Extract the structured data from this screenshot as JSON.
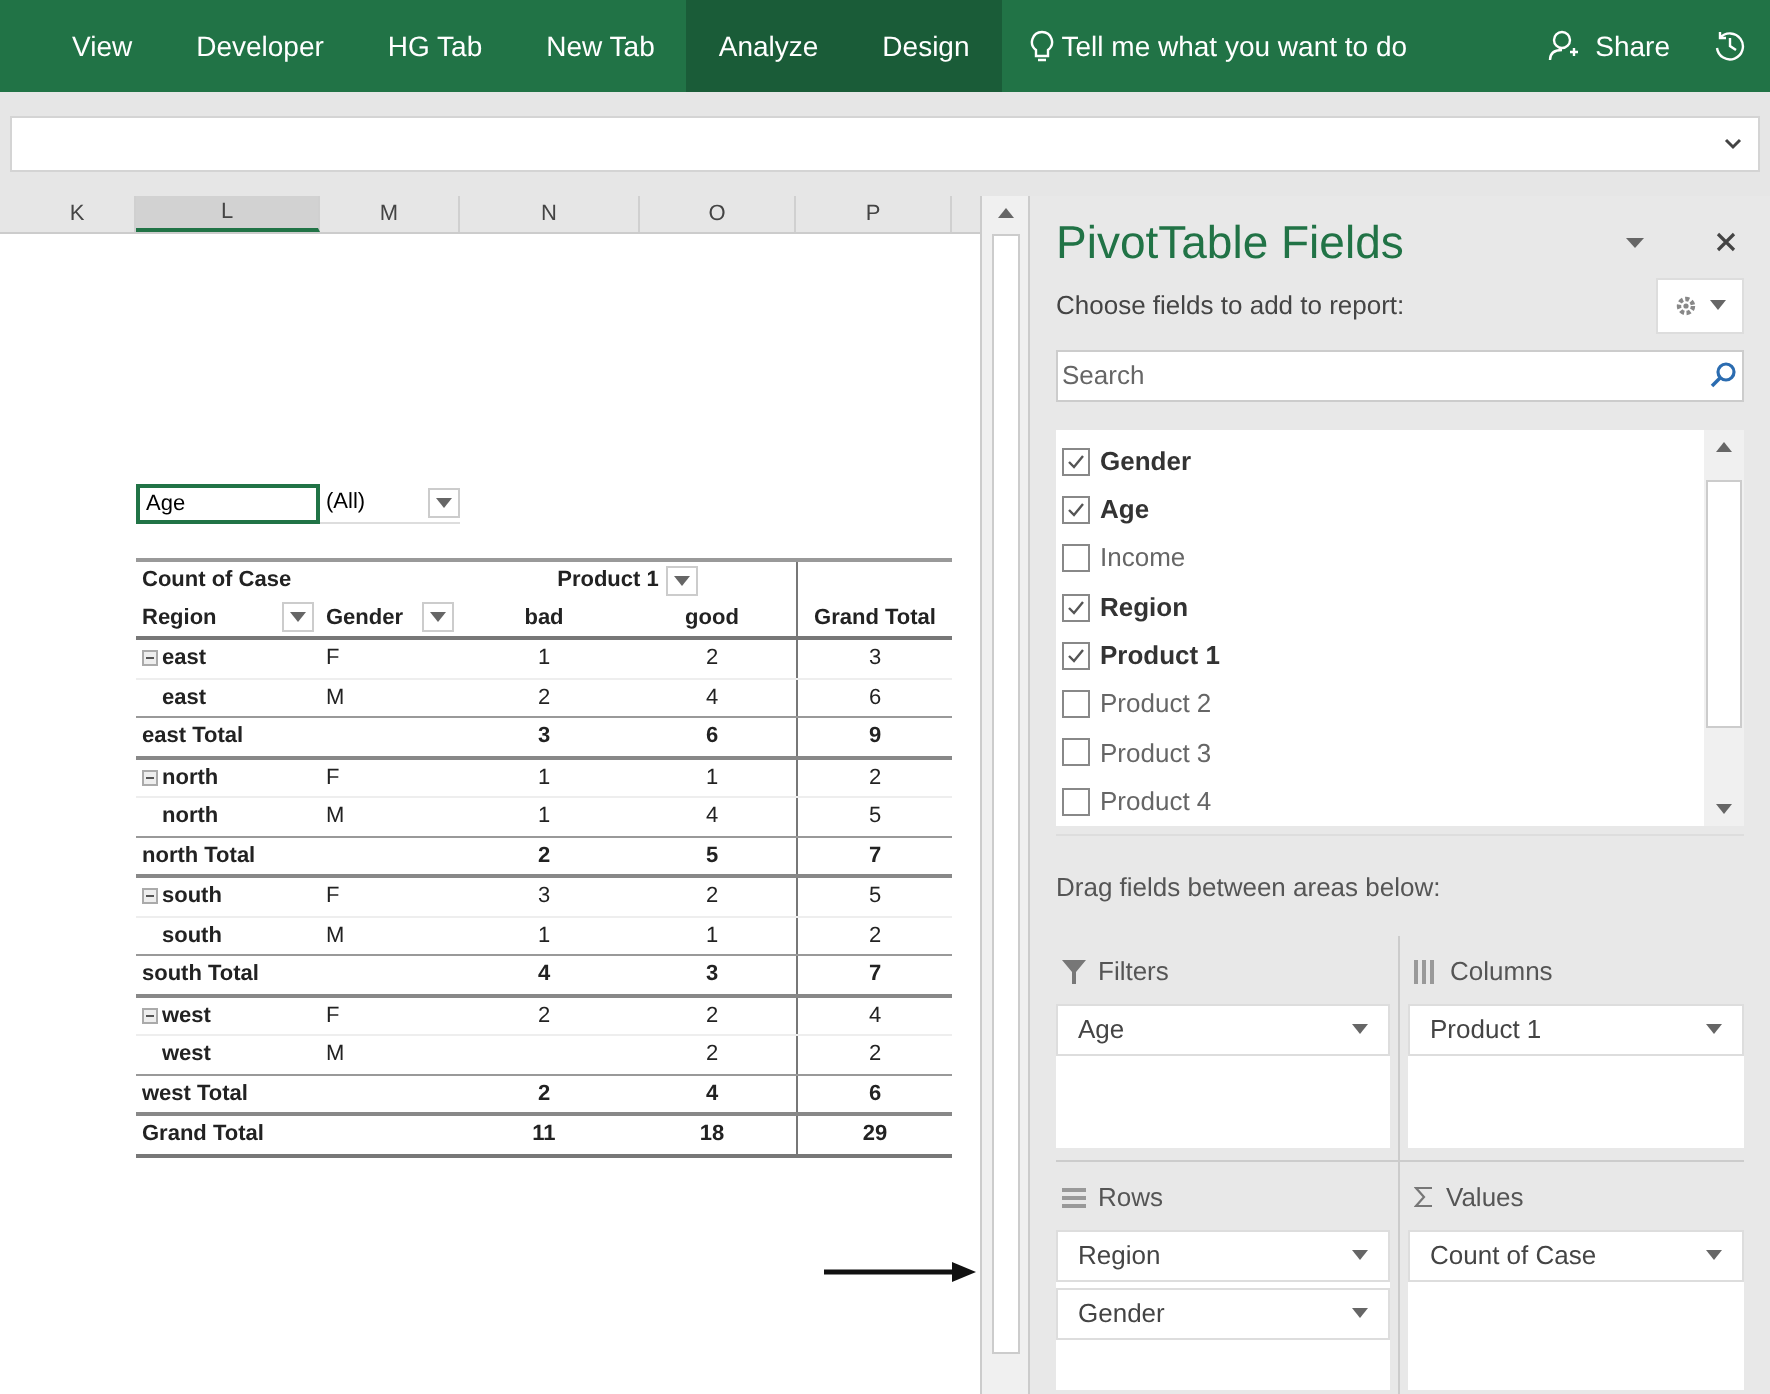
{
  "ribbon": {
    "tabs": [
      {
        "label": "View",
        "selected": false
      },
      {
        "label": "Developer",
        "selected": false
      },
      {
        "label": "HG Tab",
        "selected": false
      },
      {
        "label": "New Tab",
        "selected": false
      },
      {
        "label": "Analyze",
        "selected": true
      },
      {
        "label": "Design",
        "selected": true
      }
    ],
    "tell_me": "Tell me what you want to do",
    "share": "Share"
  },
  "column_headers": [
    {
      "label": "K",
      "selected": false
    },
    {
      "label": "L",
      "selected": true
    },
    {
      "label": "M",
      "selected": false
    },
    {
      "label": "N",
      "selected": false
    },
    {
      "label": "O",
      "selected": false
    },
    {
      "label": "P",
      "selected": false
    }
  ],
  "pivot": {
    "filter": {
      "field": "Age",
      "value": "(All)"
    },
    "values_label": "Count of Case",
    "column_field": "Product 1",
    "row_fields": [
      "Region",
      "Gender"
    ],
    "column_items": [
      "bad",
      "good"
    ],
    "grand_total_label": "Grand Total",
    "rows": [
      {
        "kind": "group_start",
        "region": "east",
        "gender": "F",
        "bad": "1",
        "good": "2",
        "total": "3"
      },
      {
        "kind": "item",
        "region": "east",
        "gender": "M",
        "bad": "2",
        "good": "4",
        "total": "6"
      },
      {
        "kind": "subtotal",
        "region": "east Total",
        "bad": "3",
        "good": "6",
        "total": "9"
      },
      {
        "kind": "group_start",
        "region": "north",
        "gender": "F",
        "bad": "1",
        "good": "1",
        "total": "2"
      },
      {
        "kind": "item",
        "region": "north",
        "gender": "M",
        "bad": "1",
        "good": "4",
        "total": "5"
      },
      {
        "kind": "subtotal",
        "region": "north Total",
        "bad": "2",
        "good": "5",
        "total": "7"
      },
      {
        "kind": "group_start",
        "region": "south",
        "gender": "F",
        "bad": "3",
        "good": "2",
        "total": "5"
      },
      {
        "kind": "item",
        "region": "south",
        "gender": "M",
        "bad": "1",
        "good": "1",
        "total": "2"
      },
      {
        "kind": "subtotal",
        "region": "south Total",
        "bad": "4",
        "good": "3",
        "total": "7"
      },
      {
        "kind": "group_start",
        "region": "west",
        "gender": "F",
        "bad": "2",
        "good": "2",
        "total": "4"
      },
      {
        "kind": "item",
        "region": "west",
        "gender": "M",
        "good": "2",
        "total": "2"
      },
      {
        "kind": "subtotal",
        "region": "west Total",
        "bad": "2",
        "good": "4",
        "total": "6"
      },
      {
        "kind": "grand_total",
        "region": "Grand Total",
        "bad": "11",
        "good": "18",
        "total": "29"
      }
    ]
  },
  "pane": {
    "title": "PivotTable Fields",
    "subtitle": "Choose fields to add to report:",
    "search": {
      "placeholder": "Search"
    },
    "fields": [
      {
        "label": "Gender",
        "checked": true
      },
      {
        "label": "Age",
        "checked": true
      },
      {
        "label": "Income",
        "checked": false
      },
      {
        "label": "Region",
        "checked": true
      },
      {
        "label": "Product 1",
        "checked": true
      },
      {
        "label": "Product 2",
        "checked": false
      },
      {
        "label": "Product 3",
        "checked": false
      },
      {
        "label": "Product 4",
        "checked": false
      }
    ],
    "drag_hint": "Drag fields between areas below:",
    "areas": [
      {
        "kind": "filters",
        "title": "Filters",
        "items": [
          "Age"
        ]
      },
      {
        "kind": "columns",
        "title": "Columns",
        "items": [
          "Product 1"
        ]
      },
      {
        "kind": "rows",
        "title": "Rows",
        "items": [
          "Region",
          "Gender"
        ]
      },
      {
        "kind": "values",
        "title": "Values",
        "items": [
          "Count of Case"
        ]
      }
    ]
  }
}
